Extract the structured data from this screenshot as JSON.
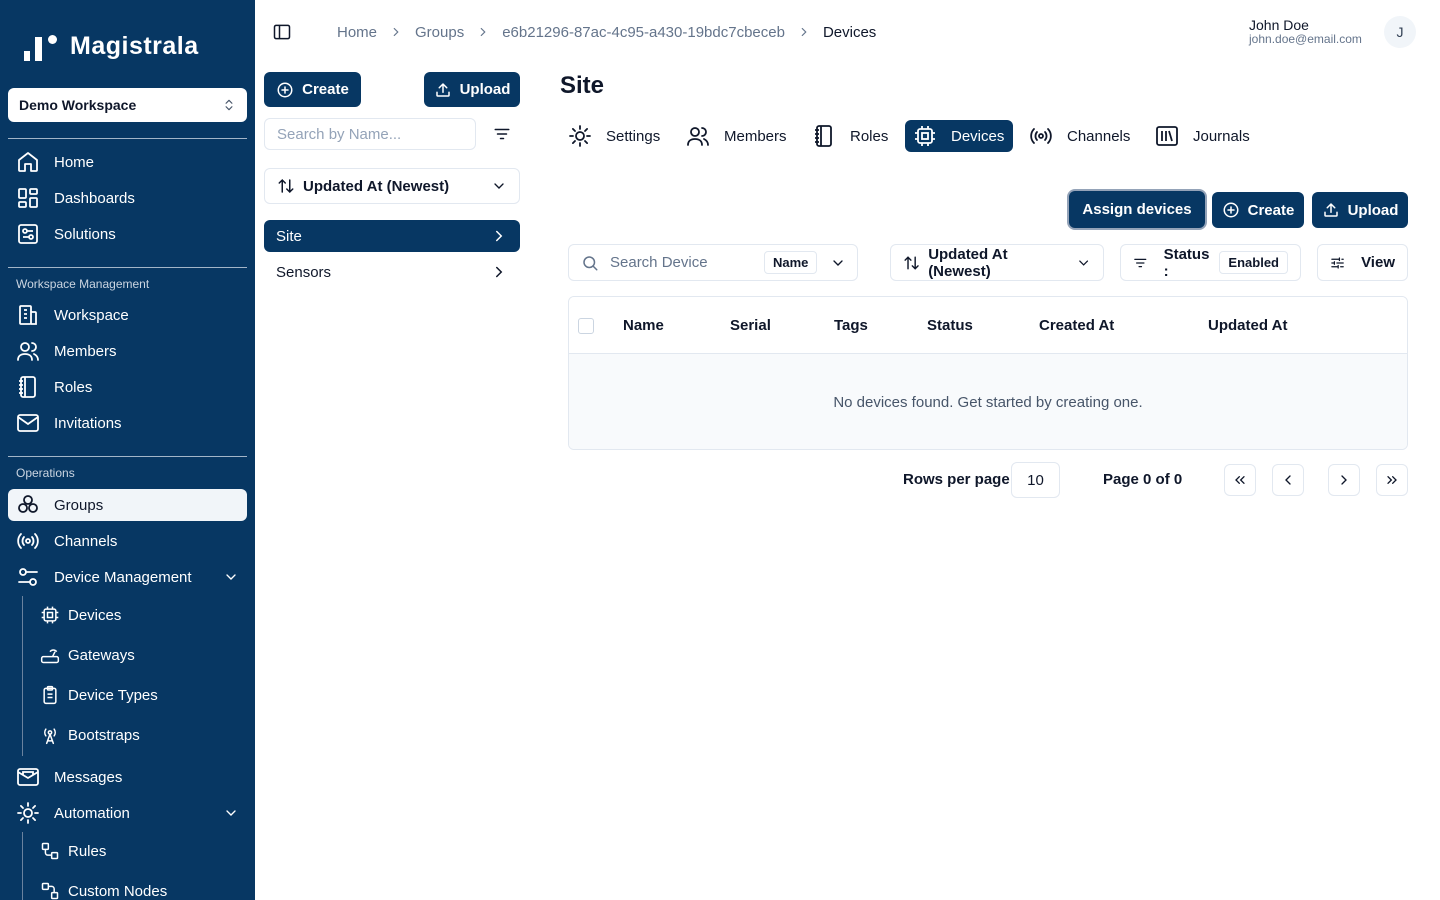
{
  "app": {
    "logo_text": "Magistrala",
    "workspace": "Demo Workspace"
  },
  "sidebar": {
    "top_items": [
      {
        "label": "Home",
        "icon": "home-icon"
      },
      {
        "label": "Dashboards",
        "icon": "dashboard-icon"
      },
      {
        "label": "Solutions",
        "icon": "solutions-icon"
      }
    ],
    "workspace_section": "Workspace Management",
    "workspace_items": [
      {
        "label": "Workspace",
        "icon": "building-icon"
      },
      {
        "label": "Members",
        "icon": "users-icon"
      },
      {
        "label": "Roles",
        "icon": "notebook-icon"
      },
      {
        "label": "Invitations",
        "icon": "mail-icon"
      }
    ],
    "operations_section": "Operations",
    "operations_items": [
      {
        "label": "Groups",
        "icon": "groups-icon",
        "active": true
      },
      {
        "label": "Channels",
        "icon": "radio-icon"
      },
      {
        "label": "Device Management",
        "icon": "settings-sliders-icon",
        "expanded": true
      }
    ],
    "device_management_items": [
      {
        "label": "Devices",
        "icon": "cpu-icon"
      },
      {
        "label": "Gateways",
        "icon": "router-icon"
      },
      {
        "label": "Device Types",
        "icon": "clipboard-icon"
      },
      {
        "label": "Bootstraps",
        "icon": "antenna-icon"
      }
    ],
    "bottom_items": [
      {
        "label": "Messages",
        "icon": "mail-open-icon"
      },
      {
        "label": "Automation",
        "icon": "cog-icon",
        "expanded": true
      }
    ],
    "automation_items": [
      {
        "label": "Rules",
        "icon": "workflow-icon"
      },
      {
        "label": "Custom Nodes",
        "icon": "nodes-icon"
      }
    ]
  },
  "breadcrumb": [
    "Home",
    "Groups",
    "e6b21296-87ac-4c95-a430-19bdc7cbeceb",
    "Devices"
  ],
  "user": {
    "name": "John Doe",
    "email": "john.doe@email.com",
    "initial": "J"
  },
  "groups_panel": {
    "create_label": "Create",
    "upload_label": "Upload",
    "search_placeholder": "Search by Name...",
    "sort_label": "Updated At (Newest)",
    "items": [
      {
        "label": "Site",
        "active": true
      },
      {
        "label": "Sensors",
        "active": false
      }
    ]
  },
  "main": {
    "title": "Site",
    "tabs": [
      {
        "label": "Settings",
        "icon": "settings-icon"
      },
      {
        "label": "Members",
        "icon": "users-icon"
      },
      {
        "label": "Roles",
        "icon": "notebook-icon"
      },
      {
        "label": "Devices",
        "icon": "cpu-icon",
        "active": true
      },
      {
        "label": "Channels",
        "icon": "radio-icon"
      },
      {
        "label": "Journals",
        "icon": "library-icon"
      }
    ],
    "actions": {
      "assign_label": "Assign devices",
      "create_label": "Create",
      "upload_label": "Upload"
    },
    "search_placeholder": "Search Device",
    "search_field": "Name",
    "sort_label": "Updated At (Newest)",
    "status_label": "Status :",
    "status_value": "Enabled",
    "view_label": "View",
    "table": {
      "columns": [
        "Name",
        "Serial",
        "Tags",
        "Status",
        "Created At",
        "Updated At"
      ],
      "empty_text": "No devices found. Get started by creating one."
    },
    "pagination": {
      "rows_label": "Rows per page",
      "rows_value": "10",
      "page_text": "Page 0 of 0"
    }
  },
  "colors": {
    "brand": "#073763",
    "border": "#e2e8f0"
  }
}
